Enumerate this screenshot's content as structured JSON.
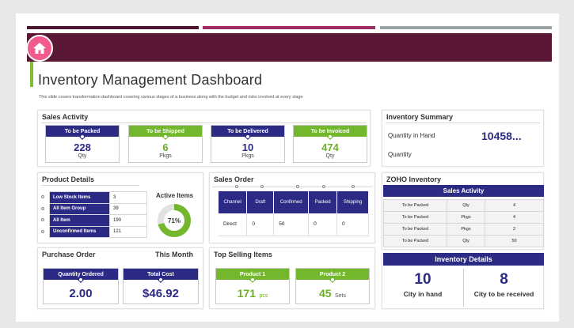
{
  "header": {
    "title": "Inventory Management Dashboard",
    "subtitle": "This slide covers transformation dashboard covering various stages of a business along with the budget and risks involved at every stage",
    "home_icon": "home-icon"
  },
  "colors": {
    "navy": "#2b2a85",
    "green": "#73b82c",
    "banner": "#5a1736",
    "home": "#f05a8d",
    "accent": "#7dbf2e"
  },
  "sales_activity": {
    "title": "Sales Activity",
    "cards": [
      {
        "label": "To be Packed",
        "value": "228",
        "unit": "Qty",
        "color": "navy"
      },
      {
        "label": "To be Shipped",
        "value": "6",
        "unit": "Pkgs",
        "color": "green"
      },
      {
        "label": "To be Delivered",
        "value": "10",
        "unit": "Pkgs",
        "color": "navy"
      },
      {
        "label": "To be Invoiced",
        "value": "474",
        "unit": "Qty",
        "color": "green"
      }
    ]
  },
  "inventory_summary": {
    "title": "Inventory Summary",
    "qty_in_hand_label": "Quantity in Hand",
    "qty_in_hand_value": "10458...",
    "quantity_label": "Quantity"
  },
  "product_details": {
    "title": "Product Details",
    "rows": [
      {
        "label": "Low Stock Items",
        "value": "3"
      },
      {
        "label": "All Item Group",
        "value": "39"
      },
      {
        "label": "All Item",
        "value": "190"
      },
      {
        "label": "Unconfirmed Items",
        "value": "121"
      }
    ],
    "active_items_label": "Active Items",
    "active_items_percent": "71%",
    "active_items_fraction": 0.71
  },
  "sales_order": {
    "title": "Sales Order",
    "columns": [
      "Channel",
      "Draft",
      "Confirmed",
      "Packed",
      "Shipping"
    ],
    "rows": [
      [
        "Direct",
        "0",
        "50",
        "0",
        "0"
      ]
    ]
  },
  "zoho_inventory": {
    "title": "ZOHO Inventory",
    "table_title": "Sales Activity",
    "rows": [
      [
        "To be Packed",
        "Qty",
        "4"
      ],
      [
        "To be Packed",
        "Pkgs",
        "4"
      ],
      [
        "To be Packed",
        "Pkgs",
        "2"
      ],
      [
        "To be Packed",
        "Qty",
        "50"
      ]
    ]
  },
  "purchase_order": {
    "title": "Purchase Order",
    "period": "This Month",
    "cards": [
      {
        "label": "Quantity Ordered",
        "value": "2.00"
      },
      {
        "label": "Total Cost",
        "value": "$46.92"
      }
    ]
  },
  "top_selling": {
    "title": "Top Selling Items",
    "cards": [
      {
        "label": "Product 1",
        "value": "171",
        "unit": "pcs"
      },
      {
        "label": "Product 2",
        "value": "45",
        "unit": "Sets"
      }
    ]
  },
  "inventory_details": {
    "title": "Inventory Details",
    "items": [
      {
        "value": "10",
        "label": "City in hand"
      },
      {
        "value": "8",
        "label": "City to be received"
      }
    ]
  }
}
